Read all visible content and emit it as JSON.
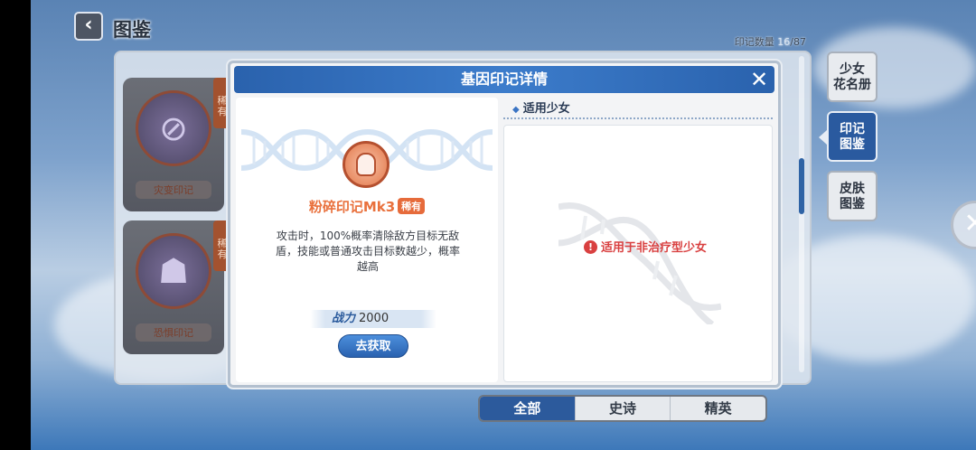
{
  "header": {
    "back_glyph": "‹",
    "title": "图鉴",
    "collect_label": "印记数量",
    "collect_owned": "16",
    "collect_total": "/87"
  },
  "side_tabs": [
    {
      "label": "少女\n花名册",
      "active": false
    },
    {
      "label": "印记\n图鉴",
      "active": true
    },
    {
      "label": "皮肤\n图鉴",
      "active": false
    }
  ],
  "cards": [
    {
      "name": "灾变印记",
      "rarity": "稀有",
      "icon": "ghost-forbidden-icon"
    },
    {
      "name": "恐惧印记",
      "rarity": "稀有",
      "icon": "ghost-icon"
    }
  ],
  "bottom_tabs": [
    {
      "label": "全部",
      "active": true
    },
    {
      "label": "史诗",
      "active": false
    },
    {
      "label": "精英",
      "active": false
    }
  ],
  "dialog": {
    "title": "基因印记详情",
    "close_glyph": "✕",
    "mark_name": "粉碎印记Mk3",
    "rarity": "稀有",
    "description": "攻击时，100%概率清除敌方目标无敌盾，技能或普通攻击目标数越少，概率越高",
    "power_label": "战力",
    "power_value": "2000",
    "get_button": "去获取",
    "section_title": "适用少女",
    "warning": "适用于非治疗型少女"
  },
  "colors": {
    "accent_blue": "#2a62ad",
    "rarity_orange": "#e66b3b",
    "warning_red": "#d94040"
  },
  "icons": {
    "dna": "dna-helix-icon",
    "mark": "shatter-mark-icon",
    "warning": "exclamation-circle-icon",
    "close": "close-icon"
  }
}
